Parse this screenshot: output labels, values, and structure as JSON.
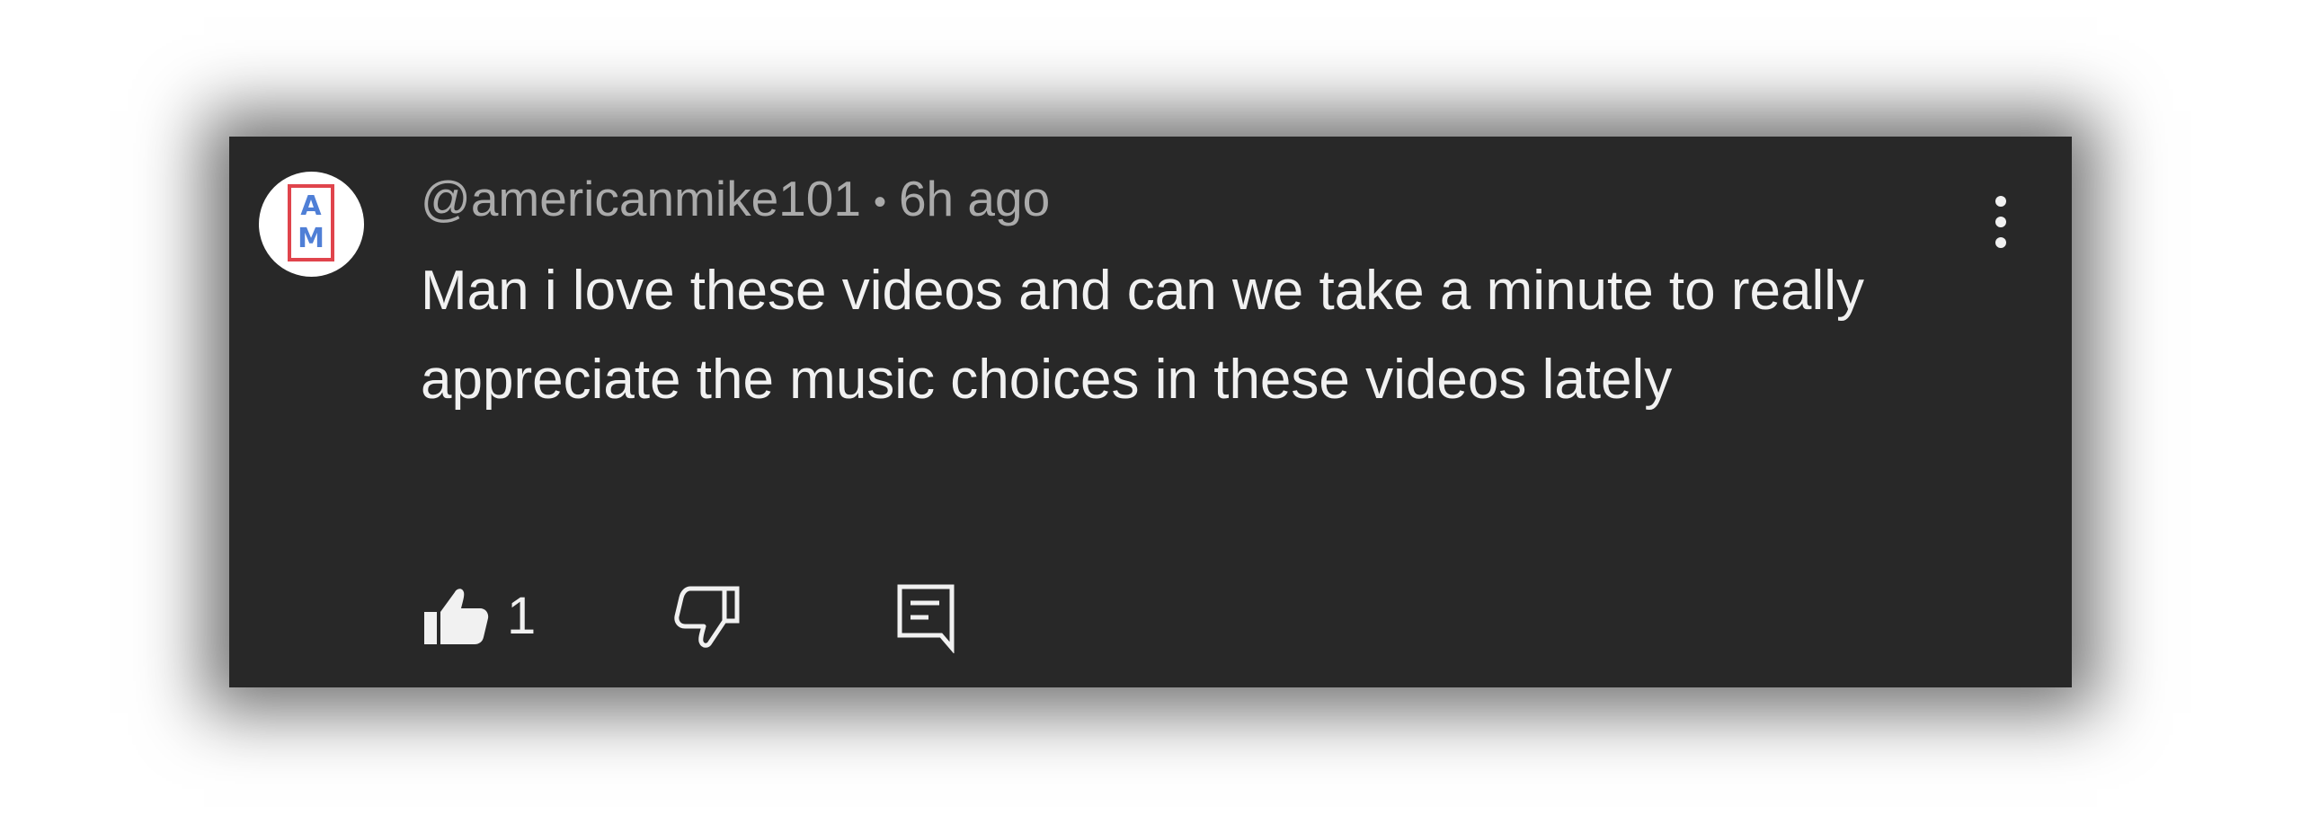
{
  "comment": {
    "avatar": {
      "initials_top": "A",
      "initials_bottom": "M",
      "accent_border": "#e0444c",
      "accent_letters": "#4f7fd6"
    },
    "author": "@americanmike101",
    "separator": "•",
    "timestamp": "6h ago",
    "text": "Man i love these videos and can we take a minute to really appreciate the music choices in these videos lately",
    "actions": {
      "like_icon": "thumbs-up-filled-icon",
      "like_count": "1",
      "dislike_icon": "thumbs-down-outline-icon",
      "reply_icon": "reply-comment-icon",
      "more_icon": "more-vertical-icon"
    }
  },
  "colors": {
    "card_background": "#282828",
    "primary_text": "#f1f1f1",
    "secondary_text": "#aaaaaa"
  }
}
